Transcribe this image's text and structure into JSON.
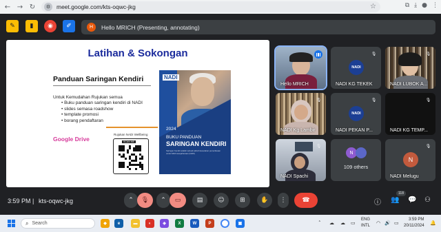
{
  "browser": {
    "url": "meet.google.com/kts-oqwc-jkg",
    "back_icon": "arrow-left",
    "forward_icon": "arrow-right",
    "reload_icon": "reload"
  },
  "meet": {
    "presenting_avatar": "H",
    "presenting_text": "Hello MRICH (Presenting, annotating)"
  },
  "slide": {
    "title": "Latihan & Sokongan",
    "subtitle": "Panduan Saringan Kendiri",
    "intro": "Untuk Kemudahan Rujukan semua",
    "bullets": [
      "Buku panduan saringan kendiri di NADI",
      "slides semasa roadshow",
      "template promosi",
      "borang pendaftaran"
    ],
    "link_text": "Google Drive",
    "qr_caption": "Rujukan NADI Wellbeing",
    "qr_scan": "SCAN ME",
    "book": {
      "logo": "NADI",
      "year": "2024",
      "title_line1": "BUKU PANDUAN",
      "title_line2": "SARINGAN KENDIRI",
      "footnote": "Saringan Kendiri adalah sebuah aktiviti kesedaran pemeriksaan untuk NADI kesejahteraan (NADI)"
    }
  },
  "participants": [
    {
      "name": "Hello MRICH",
      "state": "speaking"
    },
    {
      "name": "NADI KG TEKEK",
      "state": "muted"
    },
    {
      "name": "NADI LUBOK A...",
      "state": "muted"
    },
    {
      "name": "NADI Kg Lambir",
      "state": "muted"
    },
    {
      "name": "NADI PEKAN P...",
      "state": "muted"
    },
    {
      "name": "NADI KG TEMP...",
      "state": "muted"
    },
    {
      "name": "NADI Spachi",
      "state": "muted"
    },
    {
      "name": "109 others",
      "state": "group"
    },
    {
      "name": "NADI Melugu",
      "state": "muted",
      "initial": "N"
    }
  ],
  "others_initial": "N",
  "bottom": {
    "time": "3:59 PM",
    "separator": "|",
    "meeting_code": "kts-oqwc-jkg",
    "participant_count": "118"
  },
  "taskbar": {
    "search_placeholder": "Search",
    "lang_line1": "ENG",
    "lang_line2": "INTL",
    "clock_time": "3:59 PM",
    "clock_date": "20/11/2024"
  },
  "colors": {
    "accent_blue": "#1a73e8",
    "danger_red": "#ea4335",
    "slide_title": "#1a2a9c",
    "gdrive_pink": "#d63a9b"
  }
}
